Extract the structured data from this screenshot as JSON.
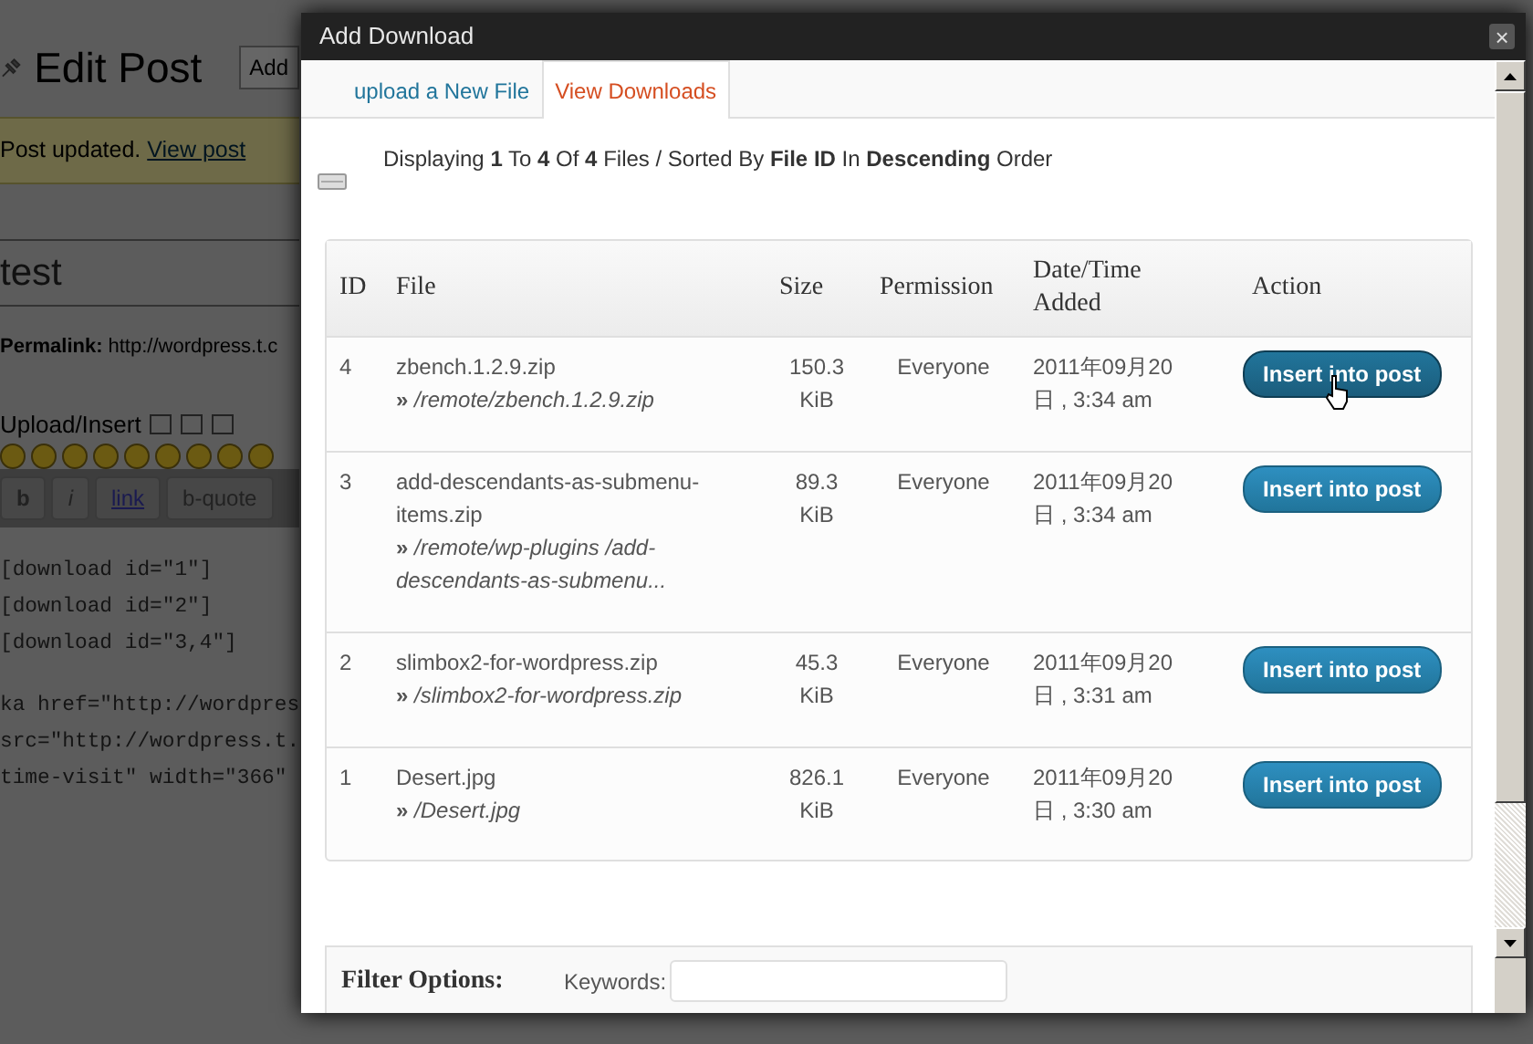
{
  "background_page": {
    "heading": "Edit Post",
    "add_button": "Add",
    "notice": {
      "text": "Post updated.",
      "link": "View post"
    },
    "post_title": "test",
    "permalink": {
      "label": "Permalink:",
      "url": "http://wordpress.t.c"
    },
    "upload_label": "Upload/Insert",
    "editor_buttons": [
      "b",
      "i",
      "link",
      "b-quote"
    ],
    "code_lines": [
      "[download id=\"1\"]",
      "[download id=\"2\"]",
      "[download id=\"3,4\"]"
    ],
    "code_lines_2": [
      "ka href=\"http://wordpres",
      "src=\"http://wordpress.t.",
      "time-visit\" width=\"366\""
    ]
  },
  "dialog": {
    "title": "Add Download",
    "close": "×",
    "tabs": [
      {
        "label": "upload a New File",
        "selected": false
      },
      {
        "label": "View Downloads",
        "selected": true
      }
    ],
    "summary": "Displaying **1** To **4** Of **4** Files / Sorted By **File ID** In **Descending** Order",
    "table": {
      "columns": [
        "ID",
        "File",
        "Size",
        "Permission",
        "Date/Time Added",
        "Action"
      ],
      "rows": [
        {
          "id": "4",
          "file": "zbench.1.2.9.zip",
          "path_marker": "»",
          "path": "/remote/zbench.1.2.9.zip",
          "size": "150.3 KiB",
          "permission": "Everyone",
          "date": "2011年09月20日 , 3:34 am",
          "action": "Insert into post",
          "hovered": true
        },
        {
          "id": "3",
          "file": "add-descendants-as-submenu-items.zip",
          "path_marker": "»",
          "path": "/remote/wp-plugins /add-descendants-as-submenu...",
          "size": "89.3 KiB",
          "permission": "Everyone",
          "date": "2011年09月20日 , 3:34 am",
          "action": "Insert into post",
          "hovered": false
        },
        {
          "id": "2",
          "file": "slimbox2-for-wordpress.zip",
          "path_marker": "»",
          "path": "/slimbox2-for-wordpress.zip",
          "size": "45.3 KiB",
          "permission": "Everyone",
          "date": "2011年09月20日 , 3:31 am",
          "action": "Insert into post",
          "hovered": false
        },
        {
          "id": "1",
          "file": "Desert.jpg",
          "path_marker": "»",
          "path": "/Desert.jpg",
          "size": "826.1 KiB",
          "permission": "Everyone",
          "date": "2011年09月20日 , 3:30 am",
          "action": "Insert into post",
          "hovered": false
        }
      ]
    },
    "filter": {
      "title": "Filter Options:",
      "keywords_label": "Keywords:"
    }
  }
}
